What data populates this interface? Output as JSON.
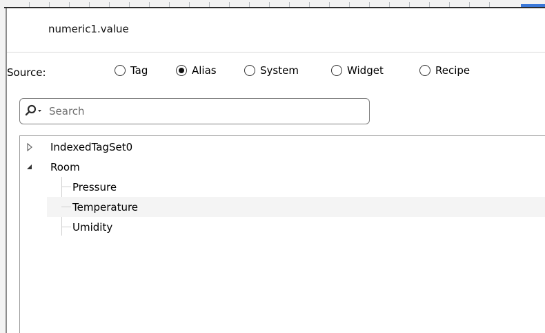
{
  "dialog": {
    "title": "numeric1.value"
  },
  "source": {
    "label": "Source:",
    "options": [
      {
        "label": "Tag",
        "selected": false
      },
      {
        "label": "Alias",
        "selected": true
      },
      {
        "label": "System",
        "selected": false
      },
      {
        "label": "Widget",
        "selected": false
      },
      {
        "label": "Recipe",
        "selected": false
      }
    ]
  },
  "search": {
    "placeholder": "Search",
    "icon": "search-icon"
  },
  "tree": {
    "nodes": [
      {
        "label": "IndexedTagSet0",
        "expanded": false
      },
      {
        "label": "Room",
        "expanded": true,
        "children": [
          "Pressure",
          "Temperature",
          "Umidity"
        ]
      }
    ]
  }
}
